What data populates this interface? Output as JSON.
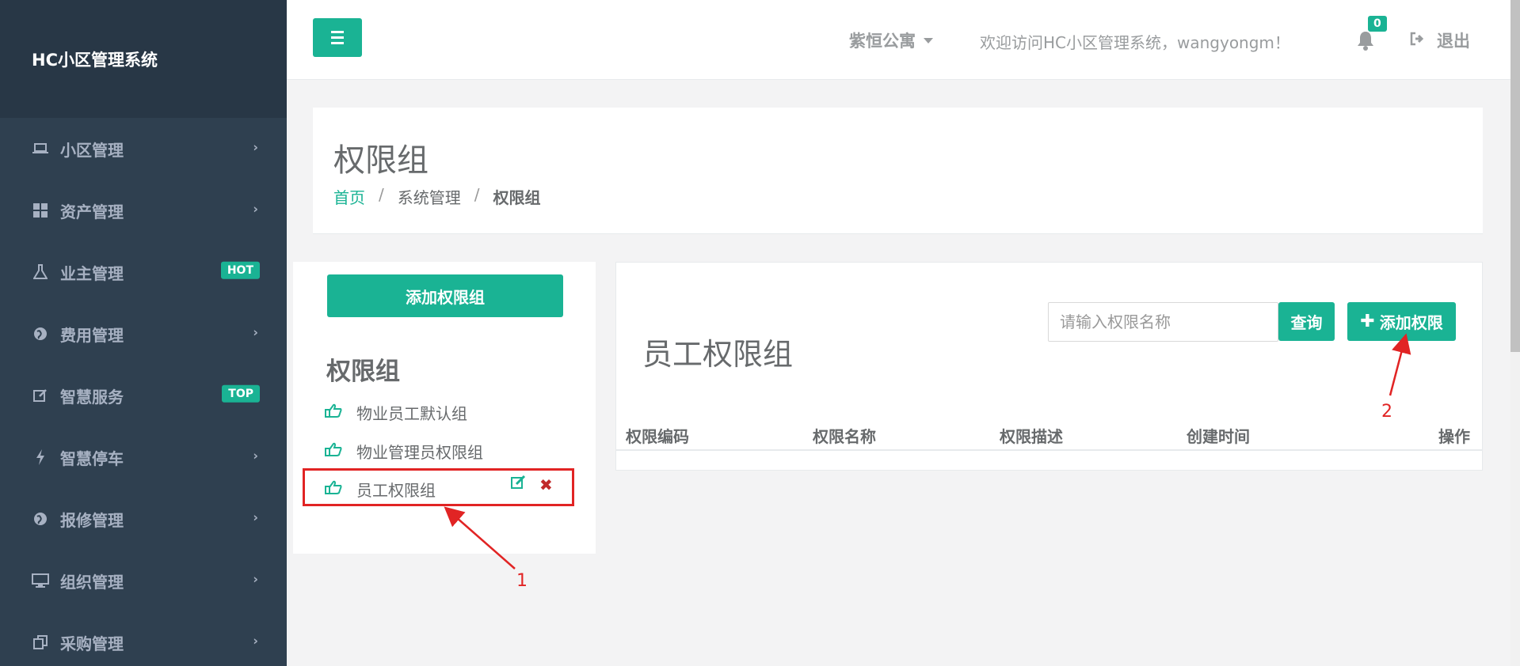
{
  "sidebar": {
    "brand": "HC小区管理系统",
    "items": [
      {
        "label": "小区管理",
        "icon": "laptop-icon",
        "badge": ""
      },
      {
        "label": "资产管理",
        "icon": "grid-icon",
        "badge": ""
      },
      {
        "label": "业主管理",
        "icon": "flask-icon",
        "badge": "HOT"
      },
      {
        "label": "费用管理",
        "icon": "globe-icon",
        "badge": ""
      },
      {
        "label": "智慧服务",
        "icon": "edit-icon",
        "badge": "TOP"
      },
      {
        "label": "智慧停车",
        "icon": "bolt-icon",
        "badge": ""
      },
      {
        "label": "报修管理",
        "icon": "globe-icon",
        "badge": ""
      },
      {
        "label": "组织管理",
        "icon": "desktop-icon",
        "badge": ""
      },
      {
        "label": "采购管理",
        "icon": "copy-icon",
        "badge": ""
      }
    ]
  },
  "topbar": {
    "community": "紫恒公寓",
    "welcome": "欢迎访问HC小区管理系统，wangyongm！",
    "notification_count": "0",
    "logout": "退出"
  },
  "heading": {
    "title": "权限组",
    "breadcrumb": {
      "home": "首页",
      "parent": "系统管理",
      "current": "权限组"
    }
  },
  "left_panel": {
    "add_button": "添加权限组",
    "title": "权限组",
    "groups": [
      "物业员工默认组",
      "物业管理员权限组",
      "员工权限组"
    ]
  },
  "right_panel": {
    "title": "员工权限组",
    "search_placeholder": "请输入权限名称",
    "query_button": "查询",
    "add_button": "添加权限",
    "columns": [
      "权限编码",
      "权限名称",
      "权限描述",
      "创建时间",
      "操作"
    ]
  },
  "annotations": {
    "label1": "1",
    "label2": "2"
  },
  "colors": {
    "accent": "#1ab394",
    "sidebar": "#2f4050",
    "annotation": "#e12424"
  }
}
